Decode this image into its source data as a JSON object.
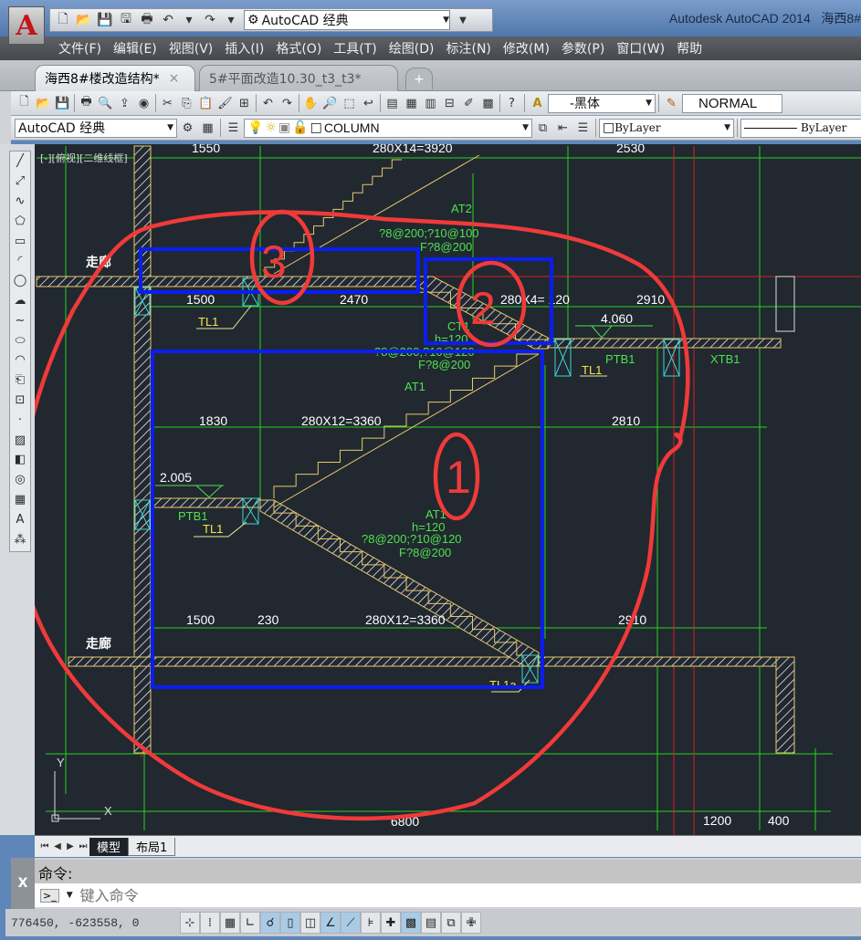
{
  "title_bar": {
    "app_title": "Autodesk AutoCAD 2014",
    "doc_title_partial": "海西8#",
    "app_button_label": "A"
  },
  "quick_access": {
    "icons": [
      "new-icon",
      "open-icon",
      "save-icon",
      "save-as-icon",
      "plot-icon",
      "undo-icon",
      "undo-dropdown-icon",
      "redo-icon",
      "redo-dropdown-icon"
    ],
    "workspace": "AutoCAD 经典"
  },
  "menu": [
    "文件(F)",
    "编辑(E)",
    "视图(V)",
    "插入(I)",
    "格式(O)",
    "工具(T)",
    "绘图(D)",
    "标注(N)",
    "修改(M)",
    "参数(P)",
    "窗口(W)",
    "帮助"
  ],
  "file_tabs": [
    {
      "label": "海西8#楼改造结构*",
      "active": true
    },
    {
      "label": "5#平面改造10.30_t3_t3*",
      "active": false
    }
  ],
  "toolbar1": {
    "icons": [
      "new-icon",
      "open-icon",
      "save-icon",
      "|",
      "plot-icon",
      "plot-preview-icon",
      "publish-icon",
      "3d-print-icon",
      "|",
      "cut-icon",
      "copy-icon",
      "paste-icon",
      "match-properties-icon",
      "block-editor-icon",
      "|",
      "undo-icon",
      "redo-icon",
      "|",
      "pan-icon",
      "zoom-realtime-icon",
      "zoom-window-icon",
      "zoom-previous-icon",
      "|",
      "properties-icon",
      "design-center-icon",
      "tool-palettes-icon",
      "sheet-set-icon",
      "markup-icon",
      "calculator-icon",
      "|",
      "help-icon"
    ],
    "text_style_font": "-黑体",
    "dim_style": "NORMAL"
  },
  "toolbar2": {
    "workspace": "AutoCAD 经典",
    "layer": "COLUMN",
    "color": "ByLayer",
    "linetype": "ByLayer"
  },
  "draw_tools": [
    "line-icon",
    "construction-line-icon",
    "polyline-icon",
    "polygon-icon",
    "rectangle-icon",
    "arc-icon",
    "circle-icon",
    "revision-cloud-icon",
    "spline-icon",
    "ellipse-icon",
    "ellipse-arc-icon",
    "insert-block-icon",
    "make-block-icon",
    "point-icon",
    "hatch-icon",
    "gradient-icon",
    "region-icon",
    "table-icon",
    "multiline-text-icon",
    "add-selected-icon"
  ],
  "viewport": {
    "label": "[-][俯视][二维线框]"
  },
  "drawing": {
    "dims": {
      "top_left": "1550",
      "top_flight": "280X14=3920",
      "top_right": "2530",
      "row2_left": "1500",
      "row2_mid": "2470",
      "row2_flight": "280X4= 120",
      "row2_right": "2910",
      "row3_left": "1830",
      "row3_flight": "280X12=3360",
      "row3_right": "2810",
      "row4_left": "1500",
      "row4_gap": "230",
      "row4_flight": "280X12=3360",
      "row4_right": "2910",
      "bottom_total": "6800",
      "bottom_b": "1200",
      "bottom_c": "400"
    },
    "labels": {
      "corridor_top": "走廊",
      "corridor_bottom": "走廊",
      "at2": "AT2",
      "at2_rebar": "?8@200;?10@100",
      "at2_f": "F?8@200",
      "ct1": "CT1",
      "ct1_h": "h=120",
      "ct1_rebar": "?8@200;?10@120",
      "ct1_f": "F?8@200",
      "level_upper": "4.060",
      "level_lower": "2.005",
      "ptb1_right": "PTB1",
      "xtb1": "XTB1",
      "tl1_right": "TL1",
      "at1_upper": "AT1",
      "tl1_top": "TL1",
      "ptb1_left": "PTB1",
      "tl1_left": "TL1",
      "at1_lower": "AT1",
      "at1_h": "h=120",
      "at1_rebar": "?8@200;?10@120",
      "at1_f": "F?8@200",
      "tl1a": "TL1a",
      "ucs_x": "X",
      "ucs_y": "Y"
    },
    "annotations": {
      "mark1": "1",
      "mark2": "2",
      "mark3": "3"
    }
  },
  "layout_tabs": [
    {
      "label": "模型",
      "active": true
    },
    {
      "label": "布局1",
      "active": false
    }
  ],
  "command": {
    "history": "命令:",
    "placeholder": "键入命令",
    "close": "X"
  },
  "status": {
    "coords": "776450, -623558, 0",
    "toggles": [
      {
        "icon": "infer-constraints-icon",
        "on": false
      },
      {
        "icon": "snap-mode-icon",
        "on": false
      },
      {
        "icon": "grid-display-icon",
        "on": false
      },
      {
        "icon": "ortho-mode-icon",
        "on": false
      },
      {
        "icon": "polar-tracking-icon",
        "on": true
      },
      {
        "icon": "object-snap-icon",
        "on": true
      },
      {
        "icon": "3d-object-snap-icon",
        "on": false
      },
      {
        "icon": "object-snap-tracking-icon",
        "on": true
      },
      {
        "icon": "dynamic-ucs-icon",
        "on": true
      },
      {
        "icon": "dynamic-input-icon",
        "on": false
      },
      {
        "icon": "lineweight-icon",
        "on": false
      },
      {
        "icon": "transparency-icon",
        "on": true
      },
      {
        "icon": "quick-properties-icon",
        "on": false
      },
      {
        "icon": "selection-cycling-icon",
        "on": false
      },
      {
        "icon": "annotation-monitor-icon",
        "on": false
      }
    ]
  },
  "colors": {
    "canvas": "#212830",
    "grid": "#29d21c",
    "axis": "#d62020",
    "highlight": "#0a1ef0",
    "markup": "#f03a3a",
    "stair": "#e8c86a",
    "text": "#4ee24e"
  }
}
